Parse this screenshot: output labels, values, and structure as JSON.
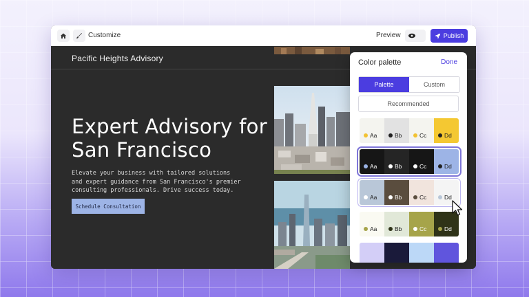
{
  "toolbar": {
    "customize_label": "Customize",
    "preview_label": "Preview",
    "publish_label": "Publish"
  },
  "site": {
    "brand": "Pacific Heights Advisory",
    "hero_title": "Expert Advisory for San Francisco",
    "hero_body": "Elevate your business with tailored solutions and expert guidance from San Francisco's premier consulting professionals. Drive success today.",
    "cta_label": "Schedule Consultation"
  },
  "panel": {
    "title": "Color palette",
    "done_label": "Done",
    "tabs": [
      {
        "label": "Palette",
        "active": true
      },
      {
        "label": "Custom",
        "active": false
      }
    ],
    "recommended_label": "Recommended",
    "palettes": [
      {
        "selected": false,
        "swatches": [
          {
            "bg": "#f4f4ef",
            "dot": "#f2c232",
            "label": "Aa",
            "text": "#222"
          },
          {
            "bg": "#e2e2e2",
            "dot": "#222222",
            "label": "Bb",
            "text": "#222"
          },
          {
            "bg": "#f4f4ef",
            "dot": "#f2c232",
            "label": "Cc",
            "text": "#222"
          },
          {
            "bg": "#f4c832",
            "dot": "#222222",
            "label": "Dd",
            "text": "#222"
          }
        ]
      },
      {
        "selected": true,
        "swatches": [
          {
            "bg": "#161616",
            "dot": "#9ab2e4",
            "label": "Aa",
            "text": "#fff"
          },
          {
            "bg": "#252525",
            "dot": "#ffffff",
            "label": "Bb",
            "text": "#fff"
          },
          {
            "bg": "#161616",
            "dot": "#ffffff",
            "label": "Cc",
            "text": "#fff"
          },
          {
            "bg": "#9db4e6",
            "dot": "#222222",
            "label": "Dd",
            "text": "#222"
          }
        ]
      },
      {
        "selected": false,
        "hovered": true,
        "swatches": [
          {
            "bg": "#b9c7d8",
            "dot": "#ffffff",
            "label": "Aa",
            "text": "#222"
          },
          {
            "bg": "#5a4d3e",
            "dot": "#ffffff",
            "label": "Bb",
            "text": "#fff"
          },
          {
            "bg": "#f1e4dd",
            "dot": "#5a4d3e",
            "label": "Cc",
            "text": "#222"
          },
          {
            "bg": "#f4f4f4",
            "dot": "#b9c7d8",
            "label": "Dd",
            "text": "#222"
          }
        ]
      },
      {
        "selected": false,
        "swatches": [
          {
            "bg": "#fafaf2",
            "dot": "#a6a44a",
            "label": "Aa",
            "text": "#222"
          },
          {
            "bg": "#e1e8d8",
            "dot": "#2f3318",
            "label": "Bb",
            "text": "#222"
          },
          {
            "bg": "#a6a44a",
            "dot": "#ffffff",
            "label": "Cc",
            "text": "#fff"
          },
          {
            "bg": "#2f3318",
            "dot": "#a6a44a",
            "label": "Dd",
            "text": "#fff"
          }
        ]
      },
      {
        "selected": false,
        "swatches": [
          {
            "bg": "#d3cef7",
            "dot": null,
            "label": "",
            "text": "#222"
          },
          {
            "bg": "#1a1a3a",
            "dot": null,
            "label": "",
            "text": "#fff"
          },
          {
            "bg": "#bcd8f7",
            "dot": null,
            "label": "",
            "text": "#222"
          },
          {
            "bg": "#6055dd",
            "dot": null,
            "label": "",
            "text": "#fff"
          }
        ]
      }
    ]
  },
  "colors": {
    "accent": "#4b3de0",
    "cta": "#9db4e6",
    "site_bg": "#2b2b2b"
  }
}
